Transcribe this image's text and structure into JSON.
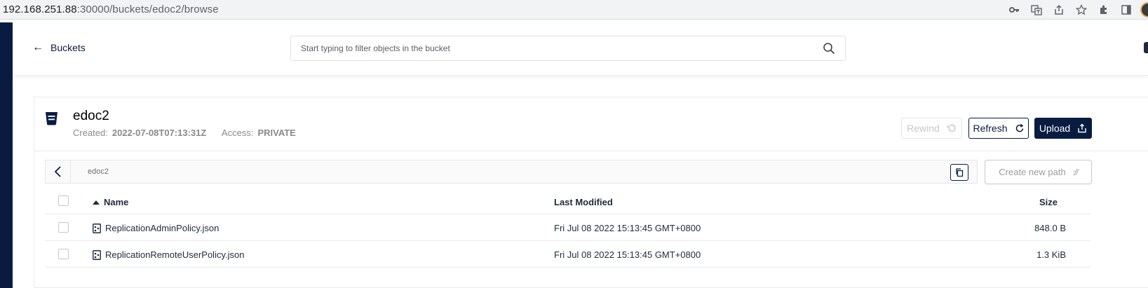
{
  "browser": {
    "url_host": "192.168.251.88",
    "url_rest": ":30000/buckets/edoc2/browse"
  },
  "header": {
    "back_label": "Buckets",
    "search_placeholder": "Start typing to filter objects in the bucket"
  },
  "bucket": {
    "name": "edoc2",
    "created_label": "Created:",
    "created_value": "2022-07-08T07:13:31Z",
    "access_label": "Access:",
    "access_value": "PRIVATE"
  },
  "actions": {
    "rewind_label": "Rewind",
    "refresh_label": "Refresh",
    "upload_label": "Upload",
    "create_path_label": "Create new path"
  },
  "path": {
    "current": "edoc2"
  },
  "table": {
    "columns": {
      "name": "Name",
      "modified": "Last Modified",
      "size": "Size"
    },
    "rows": [
      {
        "name": "ReplicationAdminPolicy.json",
        "modified": "Fri Jul 08 2022 15:13:45 GMT+0800",
        "size": "848.0 B"
      },
      {
        "name": "ReplicationRemoteUserPolicy.json",
        "modified": "Fri Jul 08 2022 15:13:45 GMT+0800",
        "size": "1.3 KiB"
      }
    ]
  },
  "colors": {
    "brand_dark": "#081c42",
    "muted_text": "#8a8a8a",
    "border": "#eaeaea"
  }
}
